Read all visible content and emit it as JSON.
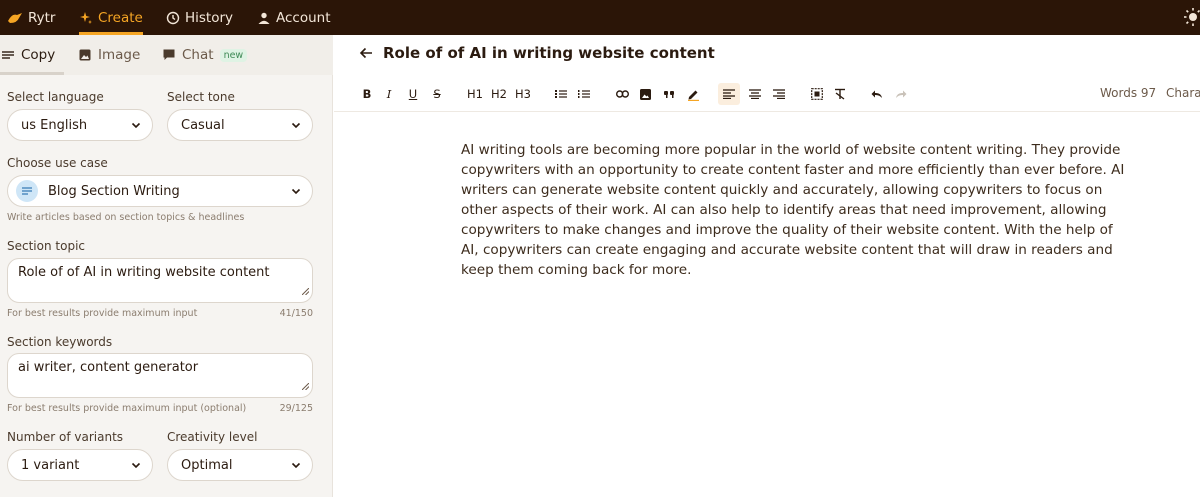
{
  "topbar": {
    "brand": "Rytr",
    "nav": [
      {
        "label": "Create",
        "active": true
      },
      {
        "label": "History"
      },
      {
        "label": "Account"
      }
    ],
    "accent_color": "#f5a524",
    "bg_color": "#2b1507"
  },
  "sidebar": {
    "tabs": [
      {
        "label": "Copy",
        "icon": "lines-icon",
        "active": true
      },
      {
        "label": "Image",
        "icon": "image-icon"
      },
      {
        "label": "Chat",
        "icon": "chat-icon",
        "badge": "new"
      }
    ],
    "language": {
      "label": "Select language",
      "value": "us English"
    },
    "tone": {
      "label": "Select tone",
      "value": "Casual"
    },
    "use_case": {
      "label": "Choose use case",
      "value": "Blog Section Writing",
      "hint": "Write articles based on section topics & headlines"
    },
    "section_topic": {
      "label": "Section topic",
      "value": "Role of of AI in writing website content",
      "hint": "For best results provide maximum input",
      "count": "41/150"
    },
    "section_keywords": {
      "label": "Section keywords",
      "value": "ai writer, content generator",
      "hint": "For best results provide maximum input (optional)",
      "count": "29/125"
    },
    "variants": {
      "label": "Number of variants",
      "value": "1 variant"
    },
    "creativity": {
      "label": "Creativity level",
      "value": "Optimal"
    }
  },
  "editor": {
    "title": "Role of of AI in writing website content",
    "toolbar": {
      "bold": "B",
      "italic": "I",
      "underline": "U",
      "strike": "S",
      "h1": "H1",
      "h2": "H2",
      "h3": "H3"
    },
    "words_label": "Words 97",
    "chars_label": "Charac",
    "content": "AI writing tools are becoming more popular in the world of website content writing. They provide copywriters with an opportunity to create content faster and more efficiently than ever before. AI writers can generate website content quickly and accurately, allowing copywriters to focus on other aspects of their work. AI can also help to identify areas that need improvement, allowing copywriters to make changes and improve the quality of their website content. With the help of AI, copywriters can create engaging and accurate website content that will draw in readers and keep them coming back for more."
  }
}
